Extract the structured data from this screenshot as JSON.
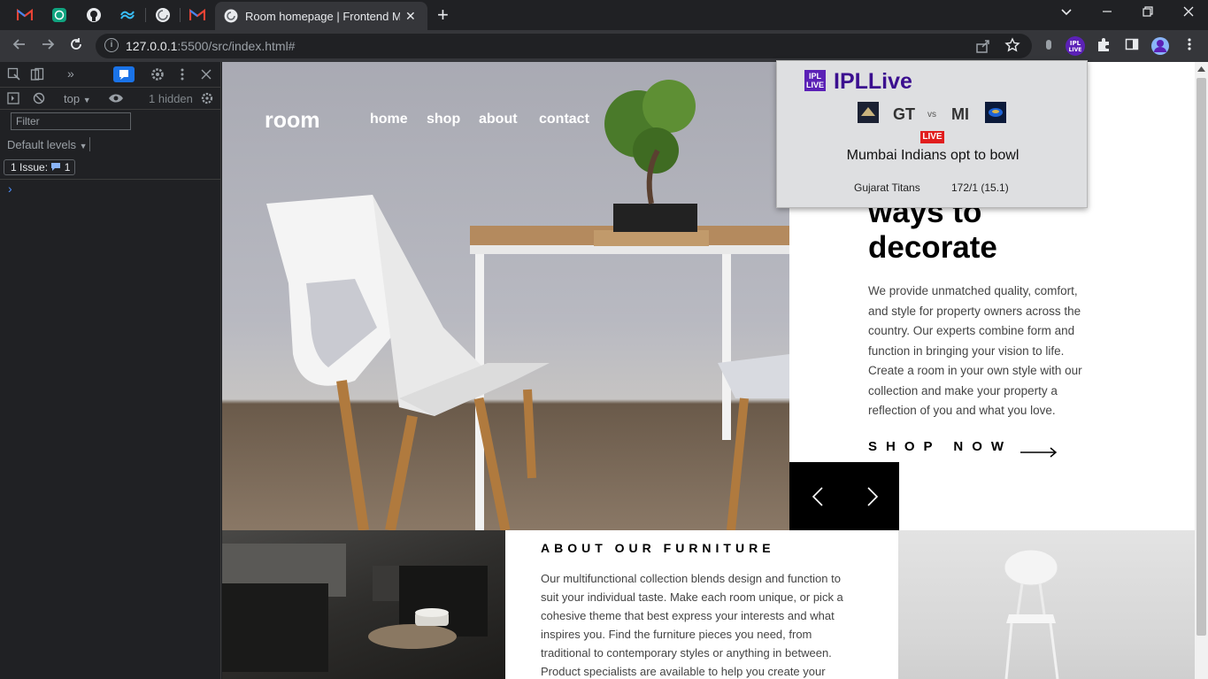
{
  "browser": {
    "active_tab_title": "Room homepage | Frontend Mer",
    "url_host": "127.0.0.1",
    "url_rest": ":5500/src/index.html#",
    "new_tab_symbol": "+",
    "close_symbol": "✕"
  },
  "devtools": {
    "context": "top",
    "hidden_count": "1 hidden",
    "filter_placeholder": "Filter",
    "levels": "Default levels",
    "issues_label": "1 Issue:",
    "issues_count": "1",
    "prompt": "›"
  },
  "page": {
    "logo": "room",
    "nav": [
      "home",
      "shop",
      "about",
      "contact"
    ],
    "heading_line1": "ways to",
    "heading_line2": "decorate",
    "paragraph": "We provide unmatched quality, comfort, and style for property owners across the country. Our experts combine form and function in bringing your vision to life. Create a room in your own style with our collection and make your property a reflection of you and what you love.",
    "shop_now": "SHOP NOW",
    "about_heading": "ABOUT OUR FURNITURE",
    "about_paragraph": "Our multifunctional collection blends design and function to suit your individual taste. Make each room unique, or pick a cohesive theme that best express your interests and what inspires you. Find the furniture pieces you need, from traditional to contemporary styles or anything in between. Product specialists are available to help you create your"
  },
  "ipl_popup": {
    "logo_text": "IPL LIVE",
    "title": "IPLLive",
    "team1": "GT",
    "vs": "vs",
    "team2": "MI",
    "live_badge": "LIVE",
    "status": "Mumbai Indians opt to bowl",
    "batting_team": "Gujarat Titans",
    "score": "172/1 (15.1)"
  },
  "colors": {
    "chrome_dark": "#202124",
    "chrome_toolbar": "#35363a",
    "ipl_purple": "#3b0f8f",
    "live_red": "#e11d1d"
  }
}
